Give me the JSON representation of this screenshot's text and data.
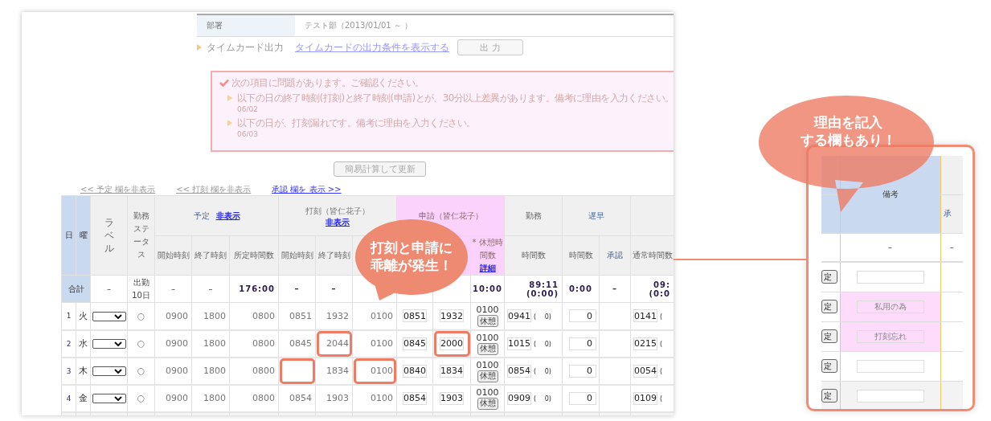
{
  "department": {
    "label": "部署",
    "value": "テスト部（2013/01/01 ～ ）"
  },
  "timecard": {
    "label": "タイムカード出力",
    "link": "タイムカードの出力条件を表示する",
    "button": "出 力"
  },
  "alert": {
    "title": "次の項目に問題があります。ご確認ください。",
    "items": [
      {
        "text": "以下の日の終了時刻(打刻)と終了時刻(申請)とが、30分以上差異があります。備考に理由を入力ください。",
        "date": "06/02"
      },
      {
        "text": "以下の日が、打刻漏れです。備考に理由を入力ください。",
        "date": "06/03"
      }
    ]
  },
  "update_button": "簡易計算して更新",
  "column_toggles": [
    {
      "text": "<< 予定 欄を非表示",
      "active": false
    },
    {
      "text": "<< 打刻 欄を非表示",
      "active": false
    },
    {
      "text": "承認 欄を 表示 >>",
      "active": true
    }
  ],
  "table": {
    "head": {
      "day": "日",
      "dow": "曜",
      "label": "ラベル",
      "status": "勤務ステータス",
      "plan": "予定",
      "plan_hide": "非表示",
      "punch": "打刻（皆仁花子）",
      "punch_hide": "非表示",
      "apply": "申請（皆仁花子）",
      "work": "勤務",
      "late": "遅早",
      "sub": {
        "plan_start": "開始時刻",
        "plan_end": "終了時刻",
        "plan_hours": "所定時間数",
        "punch_start": "開始時刻",
        "punch_end": "終了時刻",
        "apply_break": "* 休憩時間数",
        "work_hours": "時間数",
        "late_hours": "時間数",
        "late_approval": "承認",
        "normal_hours": "通常時間数"
      },
      "detail_link": "詳細"
    },
    "totals": {
      "label": "合計",
      "cells": {
        "label": "–",
        "status": "出勤 10日",
        "plan_start": "–",
        "plan_end": "–",
        "plan_hours": "176:00",
        "punch_start": "–",
        "punch_end": "–",
        "apply_break": "10:00",
        "work_hours": "89:11 (0:00)",
        "late_hours": "0:00",
        "late_approval": "–",
        "normal_hours": "09: (0:0"
      }
    },
    "rows": [
      {
        "no": "1",
        "dow": "火",
        "status": "○",
        "plan_start": "0900",
        "plan_end": "1800",
        "plan_hours": "0800",
        "punch_start": {
          "text": "0851",
          "flagged": false
        },
        "punch_end": {
          "text": "1932",
          "flagged": false
        },
        "punch_break": {
          "text": "0100",
          "flagged": false
        },
        "apply_start": "0851",
        "apply_end": {
          "text": "1932",
          "flagged": false
        },
        "apply_break": "0100",
        "break_button": "休憩",
        "work": "0941",
        "work_paren": "(　 0)",
        "late": "0",
        "normal": "0141",
        "normal_paren": "("
      },
      {
        "no": "2",
        "dow": "水",
        "status": "○",
        "plan_start": "0900",
        "plan_end": "1800",
        "plan_hours": "0800",
        "punch_start": {
          "text": "0845",
          "flagged": false
        },
        "punch_end": {
          "text": "2044",
          "flagged": true
        },
        "punch_break": {
          "text": "0100",
          "flagged": false
        },
        "apply_start": "0845",
        "apply_end": {
          "text": "2000",
          "flagged": true
        },
        "apply_break": "0100",
        "break_button": "休憩",
        "work": "1015",
        "work_paren": "(　 0)",
        "late": "0",
        "normal": "0215",
        "normal_paren": "("
      },
      {
        "no": "3",
        "dow": "木",
        "status": "○",
        "plan_start": "0900",
        "plan_end": "1800",
        "plan_hours": "0800",
        "punch_start": {
          "flagged": true
        },
        "punch_end": {
          "text": "1834",
          "flagged": false
        },
        "punch_break": {
          "text": "0100",
          "flagged": true
        },
        "apply_start": "0840",
        "apply_end": {
          "text": "1834",
          "flagged": false
        },
        "apply_break": "0100",
        "break_button": "休憩",
        "work": "0854",
        "work_paren": "(　 0)",
        "late": "0",
        "normal": "0054",
        "normal_paren": "("
      },
      {
        "no": "4",
        "dow": "金",
        "status": "○",
        "plan_start": "0900",
        "plan_end": "1800",
        "plan_hours": "0800",
        "punch_start": {
          "text": "0854",
          "flagged": false
        },
        "punch_end": {
          "text": "1903",
          "flagged": false
        },
        "punch_break": {
          "text": "0100",
          "flagged": false
        },
        "apply_start": "0854",
        "apply_end": {
          "text": "1903",
          "flagged": false
        },
        "apply_break": "0100",
        "break_button": "休憩",
        "work": "0909",
        "work_paren": "(　 0)",
        "late": "0",
        "normal": "0109",
        "normal_paren": "("
      }
    ]
  },
  "callouts": [
    [
      "打刻と申請に",
      "乖離が発生！"
    ],
    [
      "理由を記入",
      "する欄もあり！"
    ]
  ],
  "inset": {
    "header": "備考",
    "next_header": "承",
    "totals": [
      "–",
      "–"
    ],
    "rows": [
      {
        "button": "定",
        "remark": "",
        "highlighted": false
      },
      {
        "button": "定",
        "remark": "私用の為",
        "highlighted": true
      },
      {
        "button": "定",
        "remark": "打刻忘れ",
        "highlighted": true
      },
      {
        "button": "定",
        "remark": "",
        "highlighted": false
      },
      {
        "button": "定",
        "remark": "",
        "highlighted": false
      }
    ]
  }
}
